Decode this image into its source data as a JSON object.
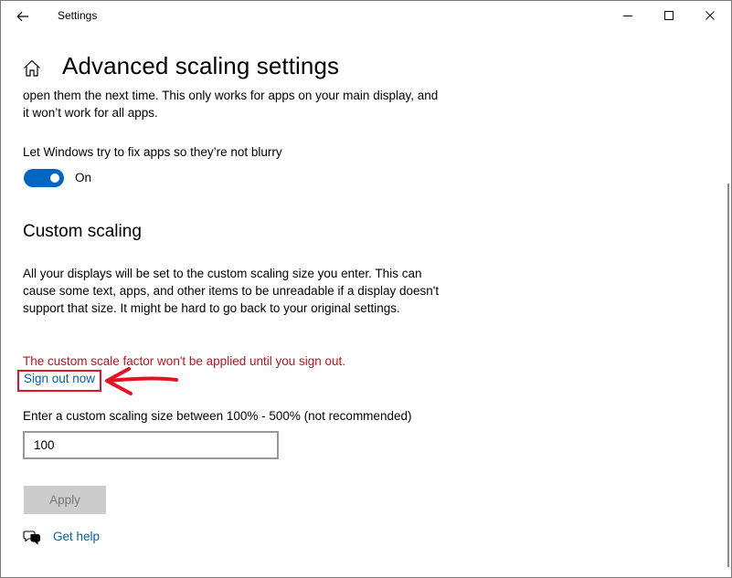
{
  "window": {
    "title": "Settings"
  },
  "header": {
    "title": "Advanced scaling settings"
  },
  "fix_apps": {
    "intro_text": "open them the next time. This only works for apps on your main display, and it won’t work for all apps.",
    "label": "Let Windows try to fix apps so they’re not blurry",
    "toggle_on": true,
    "toggle_state": "On"
  },
  "custom_scaling": {
    "title": "Custom scaling",
    "description": "All your displays will be set to the custom scaling size you enter. This can cause some text, apps, and other items to be unreadable if a display doesn't support that size. It might be hard to go back to your original settings.",
    "warning": "The custom scale factor won't be applied until you sign out.",
    "sign_out_link": "Sign out now",
    "input_label": "Enter a custom scaling size between 100% - 500% (not recommended)",
    "input_value": "100",
    "apply_label": "Apply"
  },
  "help": {
    "label": "Get help"
  },
  "colors": {
    "accent": "#0067c0",
    "link": "#0063b1",
    "warning": "#c50f1f",
    "annotation": "#e81123"
  },
  "icons": {
    "back": "back-arrow-icon",
    "home": "home-icon",
    "minimize": "minimize-icon",
    "maximize": "maximize-icon",
    "close": "close-icon",
    "help": "chat-help-icon"
  }
}
